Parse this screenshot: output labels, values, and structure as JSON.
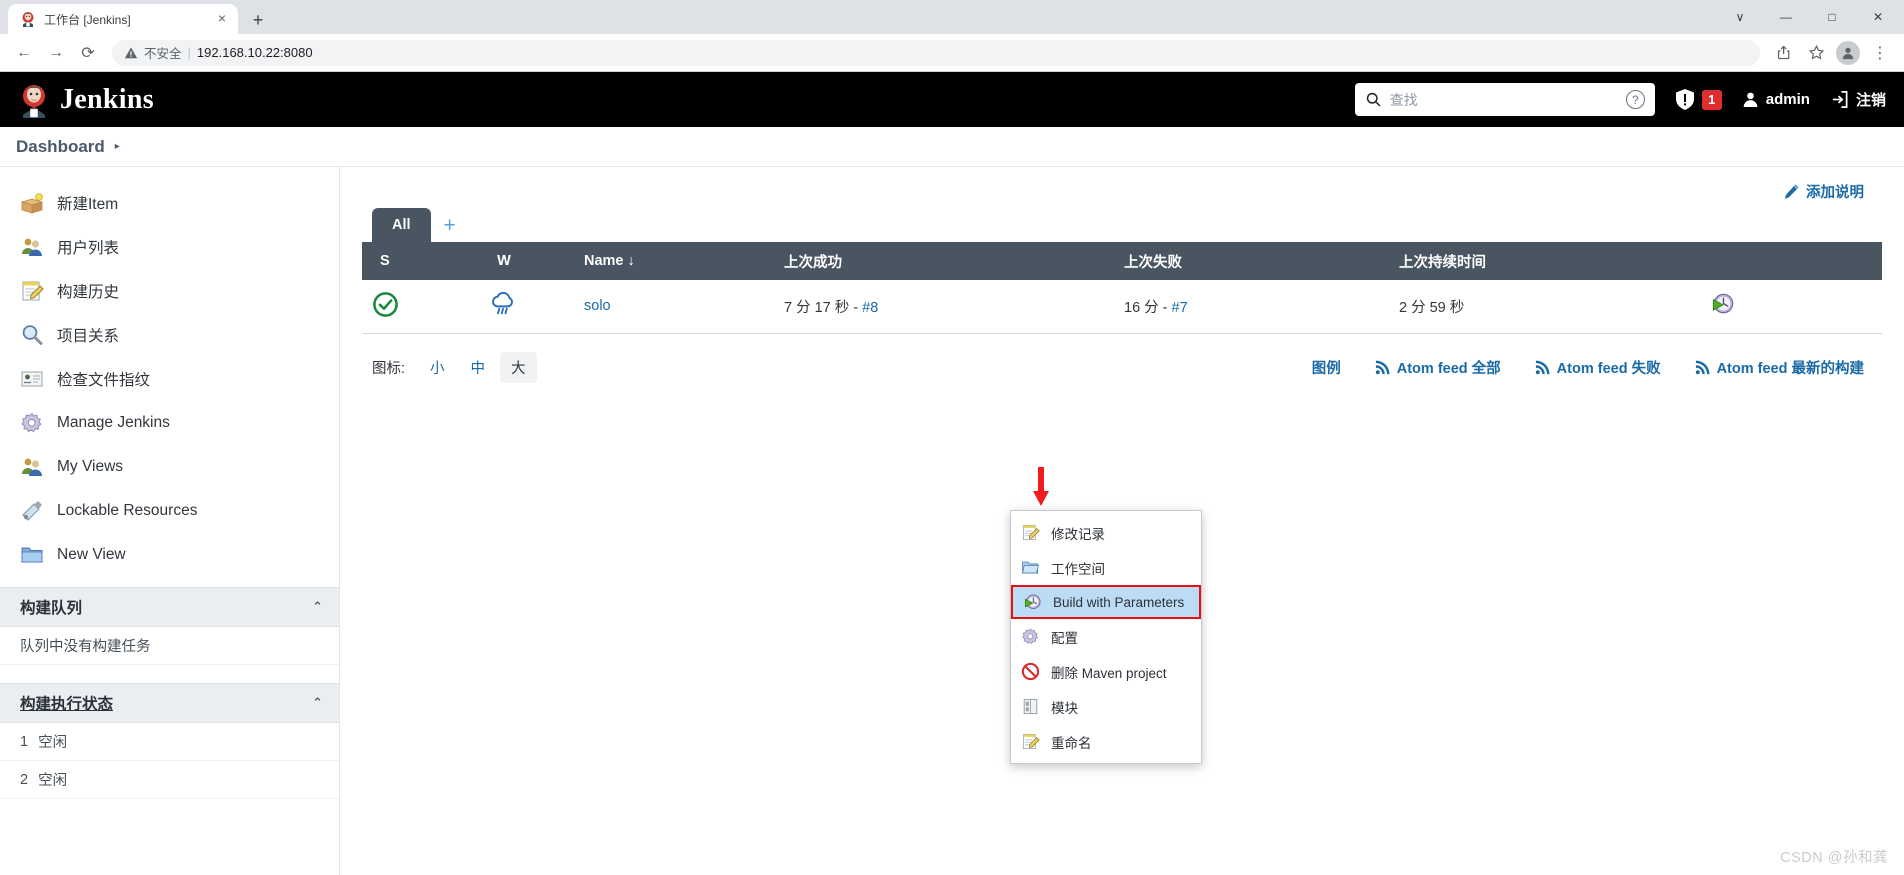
{
  "browser": {
    "tab_title": "工作台 [Jenkins]",
    "tab_close": "×",
    "new_tab": "+",
    "win_minimize": "—",
    "win_maximize": "□",
    "win_close": "✕",
    "win_chevron": "∨",
    "back": "←",
    "forward": "→",
    "reload": "⟳",
    "insecure_label": "不安全",
    "url": "192.168.10.22:8080",
    "menu_dots": "⋮"
  },
  "jenkins_header": {
    "brand": "Jenkins",
    "search_placeholder": "查找",
    "search_value": "",
    "help": "?",
    "alert_count": "1",
    "user": "admin",
    "logout": "注销"
  },
  "breadcrumb": {
    "items": [
      "Dashboard"
    ],
    "caret": "▸"
  },
  "sidebar": {
    "items": [
      {
        "label": "新建Item",
        "icon": "new-item-icon"
      },
      {
        "label": "用户列表",
        "icon": "users-icon"
      },
      {
        "label": "构建历史",
        "icon": "build-history-icon"
      },
      {
        "label": "项目关系",
        "icon": "project-relationship-icon"
      },
      {
        "label": "检查文件指纹",
        "icon": "fingerprint-icon"
      },
      {
        "label": "Manage Jenkins",
        "icon": "gear-icon"
      },
      {
        "label": "My Views",
        "icon": "my-views-icon"
      },
      {
        "label": "Lockable Resources",
        "icon": "lockable-resources-icon"
      },
      {
        "label": "New View",
        "icon": "folder-icon"
      }
    ],
    "build_queue": {
      "title": "构建队列",
      "caret": "⌃",
      "empty_text": "队列中没有构建任务"
    },
    "executor_status": {
      "title": "构建执行状态",
      "caret": "⌃",
      "rows": [
        {
          "num": "1",
          "state": "空闲"
        },
        {
          "num": "2",
          "state": "空闲"
        }
      ]
    }
  },
  "main": {
    "add_description": "添加说明",
    "view_tab": "All",
    "view_add": "+",
    "table": {
      "headers": [
        "S",
        "W",
        "Name ↓",
        "上次成功",
        "上次失败",
        "上次持续时间",
        ""
      ],
      "rows": [
        {
          "status": "success",
          "weather": "rainy",
          "name": "solo",
          "last_success_time": "7 分 17 秒 - ",
          "last_success_build": "#8",
          "last_failure_time": "16 分 - ",
          "last_failure_build": "#7",
          "last_duration": "2 分 59 秒",
          "action_icon": "schedule-build-icon"
        }
      ]
    },
    "icon_size": {
      "label": "图标:",
      "options": [
        "小",
        "中",
        "大"
      ],
      "selected": "大"
    },
    "footer_links": {
      "legend": "图例",
      "feeds": [
        "Atom feed 全部",
        "Atom feed 失败",
        "Atom feed 最新的构建"
      ]
    }
  },
  "context_menu": {
    "items": [
      {
        "label": "修改记录",
        "icon": "changes-icon",
        "selected": false
      },
      {
        "label": "工作空间",
        "icon": "workspace-icon",
        "selected": false
      },
      {
        "label": "Build with Parameters",
        "icon": "build-params-icon",
        "selected": true
      },
      {
        "label": "配置",
        "icon": "gear-icon",
        "selected": false
      },
      {
        "label": "删除 Maven project",
        "icon": "delete-icon",
        "selected": false
      },
      {
        "label": "模块",
        "icon": "modules-icon",
        "selected": false
      },
      {
        "label": "重命名",
        "icon": "rename-icon",
        "selected": false
      }
    ]
  },
  "watermark": "CSDN @孙和龚",
  "colors": {
    "jenkins_black": "#000000",
    "table_header": "#4a5562",
    "link_blue": "#1a6aa8",
    "alert_red": "#e02e2e",
    "success_green": "#17873a",
    "weather_blue": "#2a6ebb",
    "highlight_border": "#e8110f",
    "highlight_bg": "#bcdcf5"
  }
}
